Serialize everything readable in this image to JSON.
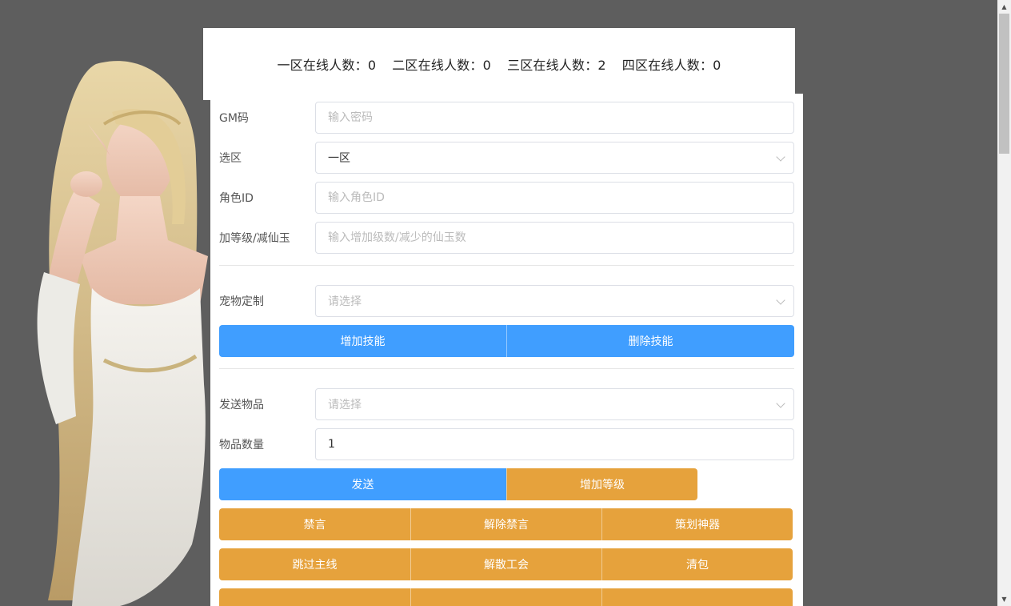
{
  "online_stats": [
    {
      "label": "一区在线人数：0"
    },
    {
      "label": "二区在线人数：0"
    },
    {
      "label": "三区在线人数：2"
    },
    {
      "label": "四区在线人数：0"
    }
  ],
  "form": {
    "gm_code": {
      "label": "GM码",
      "placeholder": "输入密码",
      "value": ""
    },
    "zone": {
      "label": "选区",
      "value": "一区"
    },
    "role_id": {
      "label": "角色ID",
      "placeholder": "输入角色ID",
      "value": ""
    },
    "level_jade": {
      "label": "加等级/减仙玉",
      "placeholder": "输入增加级数/减少的仙玉数",
      "value": ""
    },
    "pet": {
      "label": "宠物定制",
      "placeholder": "请选择"
    },
    "item": {
      "label": "发送物品",
      "placeholder": "请选择"
    },
    "item_qty": {
      "label": "物品数量",
      "value": "1"
    }
  },
  "buttons": {
    "add_skill": "增加技能",
    "delete_skill": "删除技能",
    "send": "发送",
    "add_level": "增加等级",
    "mute": "禁言",
    "unmute": "解除禁言",
    "planner_weapon": "策划神器",
    "skip_main": "跳过主线",
    "disband_guild": "解散工会",
    "clear_bag": "清包"
  },
  "colors": {
    "primary": "#409eff",
    "warning": "#e6a23c",
    "page_bg": "#5e5e5e"
  },
  "icons": {
    "select_arrow": "chevron-down-icon",
    "scroll_up": "scroll-up-arrow-icon",
    "scroll_down": "scroll-down-arrow-icon"
  }
}
